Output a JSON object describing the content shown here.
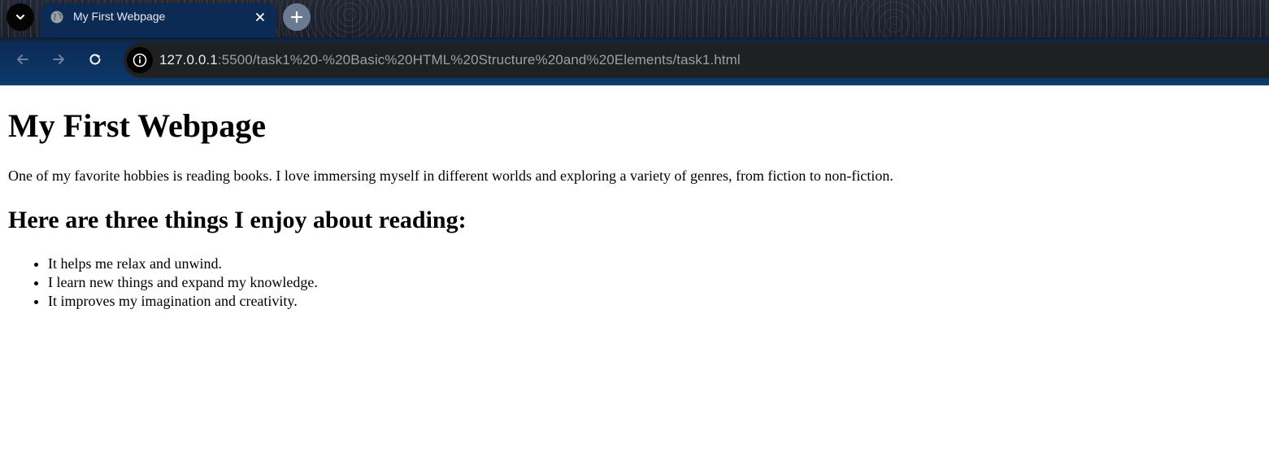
{
  "browser": {
    "tab": {
      "title": "My First Webpage",
      "favicon": "globe-icon"
    },
    "url": {
      "host": "127.0.0.1",
      "path": ":5500/task1%20-%20Basic%20HTML%20Structure%20and%20Elements/task1.html"
    },
    "colors": {
      "active_tab": "#0b2b55",
      "omnibox": "#1f2022",
      "new_tab_button": "#6a7a92"
    }
  },
  "page": {
    "heading": "My First Webpage",
    "paragraph": "One of my favorite hobbies is reading books. I love immersing myself in different worlds and exploring a variety of genres, from fiction to non-fiction.",
    "subheading": "Here are three things I enjoy about reading:",
    "list": [
      "It helps me relax and unwind.",
      "I learn new things and expand my knowledge.",
      "It improves my imagination and creativity."
    ]
  }
}
